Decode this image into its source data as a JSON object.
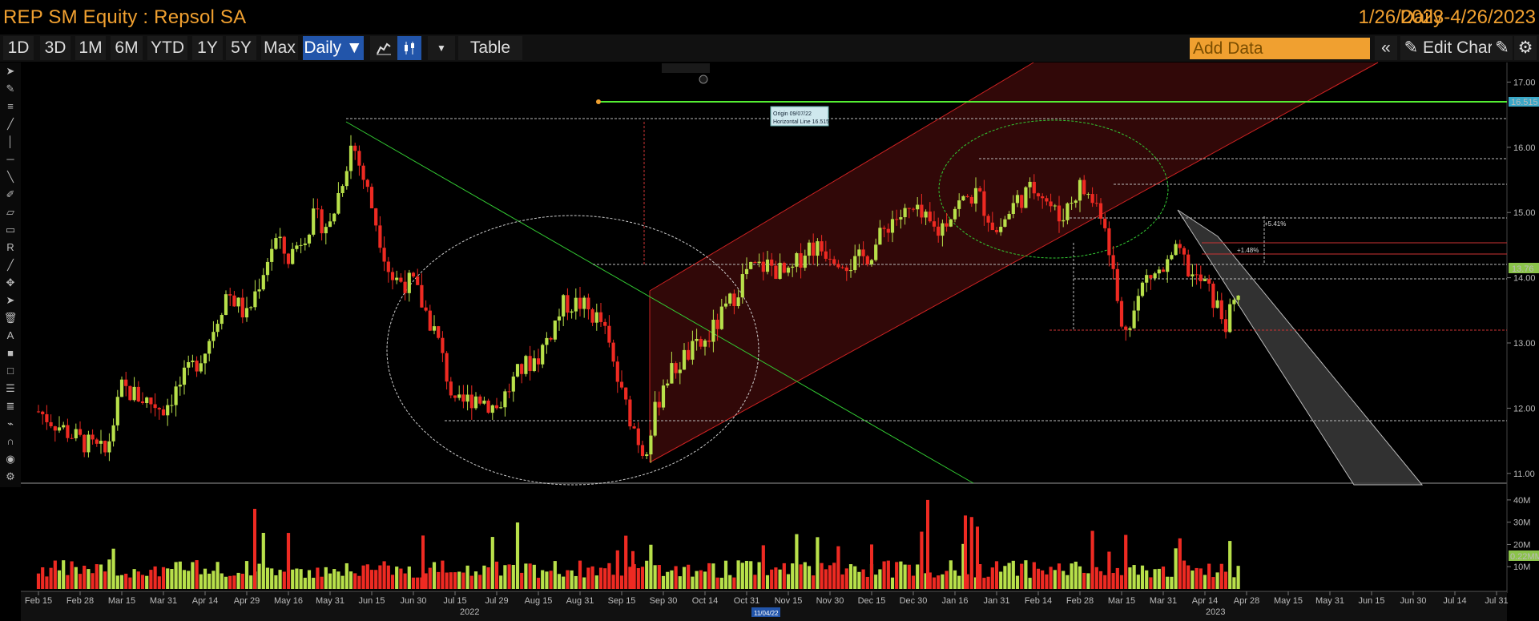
{
  "header": {
    "title": "REP SM Equity : Repsol SA",
    "period": "Daily",
    "range": "1/26/2023-4/26/2023"
  },
  "toolbar": {
    "buttons": [
      "1D",
      "3D",
      "1M",
      "6M",
      "YTD",
      "1Y",
      "5Y",
      "Max"
    ],
    "daily_label": "Daily ▼",
    "table_label": "Table",
    "add_data_placeholder": "Add Data",
    "edit_chart_label": "Edit Chart"
  },
  "annotations": {
    "tooltip_line1": "Origin 09/07/22",
    "tooltip_line2": "Horizontal Line 16.515",
    "date_marker": "11/04/22",
    "pct1": "+5.41%",
    "pct2": "+1.48%",
    "price_high": "16.515",
    "price_last": "13.76",
    "volume_last": "0.22MM"
  },
  "colors": {
    "up": "#b8e04a",
    "down": "#ee2a22",
    "accent": "#f0a030",
    "active": "#2255aa"
  },
  "chart_data": {
    "type": "candlestick",
    "title": "",
    "price_axis": {
      "ticks": [
        "17.00",
        "16.00",
        "15.00",
        "14.00",
        "13.00",
        "12.00",
        "11.00"
      ],
      "ylim": [
        10.85,
        17.3
      ]
    },
    "volume_axis": {
      "ticks": [
        "40M",
        "30M",
        "20M",
        "10M"
      ],
      "ylim": [
        0,
        45
      ]
    },
    "x_ticks": [
      "Feb 15",
      "Feb 28",
      "Mar 15",
      "Mar 31",
      "Apr 14",
      "Apr 29",
      "May 16",
      "May 31",
      "Jun 15",
      "Jun 30",
      "Jul 15",
      "Jul 29",
      "Aug 15",
      "Aug 31",
      "Sep 15",
      "Sep 30",
      "Oct 14",
      "Oct 31",
      "Nov 15",
      "Nov 30",
      "Dec 15",
      "Dec 30",
      "Jan 16",
      "Jan 31",
      "Feb 14",
      "Feb 28",
      "Mar 15",
      "Mar 31",
      "Apr 14",
      "Apr 28",
      "May 15",
      "May 31",
      "Jun 15",
      "Jun 30",
      "Jul 14",
      "Jul 31"
    ],
    "year_labels": [
      "2022",
      "2023"
    ],
    "price_path": [
      [
        "Feb 15",
        11.95
      ],
      [
        "Feb 28",
        11.5
      ],
      [
        "Mar 08",
        11.3
      ],
      [
        "Mar 15",
        12.3
      ],
      [
        "Mar 31",
        12.0
      ],
      [
        "Apr 14",
        12.9
      ],
      [
        "Apr 22",
        13.8
      ],
      [
        "Apr 29",
        13.4
      ],
      [
        "May 10",
        14.6
      ],
      [
        "May 16",
        14.3
      ],
      [
        "May 25",
        14.9
      ],
      [
        "May 31",
        14.8
      ],
      [
        "Jun 08",
        16.1
      ],
      [
        "Jun 15",
        15.1
      ],
      [
        "Jun 22",
        14.0
      ],
      [
        "Jun 30",
        13.9
      ],
      [
        "Jul 08",
        13.1
      ],
      [
        "Jul 15",
        12.0
      ],
      [
        "Jul 22",
        12.2
      ],
      [
        "Jul 29",
        12.0
      ],
      [
        "Aug 08",
        12.6
      ],
      [
        "Aug 15",
        12.8
      ],
      [
        "Aug 25",
        13.6
      ],
      [
        "Aug 31",
        13.6
      ],
      [
        "Sep 08",
        13.3
      ],
      [
        "Sep 15",
        12.2
      ],
      [
        "Sep 23",
        11.3
      ],
      [
        "Sep 30",
        12.4
      ],
      [
        "Oct 07",
        12.8
      ],
      [
        "Oct 14",
        13.0
      ],
      [
        "Oct 24",
        13.6
      ],
      [
        "Oct 31",
        14.1
      ],
      [
        "Nov 08",
        14.2
      ],
      [
        "Nov 15",
        14.0
      ],
      [
        "Nov 22",
        14.5
      ],
      [
        "Nov 30",
        14.4
      ],
      [
        "Dec 08",
        14.2
      ],
      [
        "Dec 15",
        14.4
      ],
      [
        "Dec 22",
        14.9
      ],
      [
        "Dec 30",
        15.0
      ],
      [
        "Jan 09",
        14.7
      ],
      [
        "Jan 16",
        15.1
      ],
      [
        "Jan 24",
        15.3
      ],
      [
        "Jan 31",
        14.7
      ],
      [
        "Feb 07",
        15.2
      ],
      [
        "Feb 14",
        15.4
      ],
      [
        "Feb 21",
        14.9
      ],
      [
        "Feb 28",
        15.4
      ],
      [
        "Mar 07",
        15.0
      ],
      [
        "Mar 10",
        14.4
      ],
      [
        "Mar 15",
        13.2
      ],
      [
        "Mar 20",
        13.5
      ],
      [
        "Mar 24",
        14.0
      ],
      [
        "Mar 31",
        14.1
      ],
      [
        "Apr 05",
        14.4
      ],
      [
        "Apr 10",
        14.0
      ],
      [
        "Apr 14",
        13.9
      ],
      [
        "Apr 21",
        13.3
      ],
      [
        "Apr 26",
        13.76
      ]
    ]
  }
}
